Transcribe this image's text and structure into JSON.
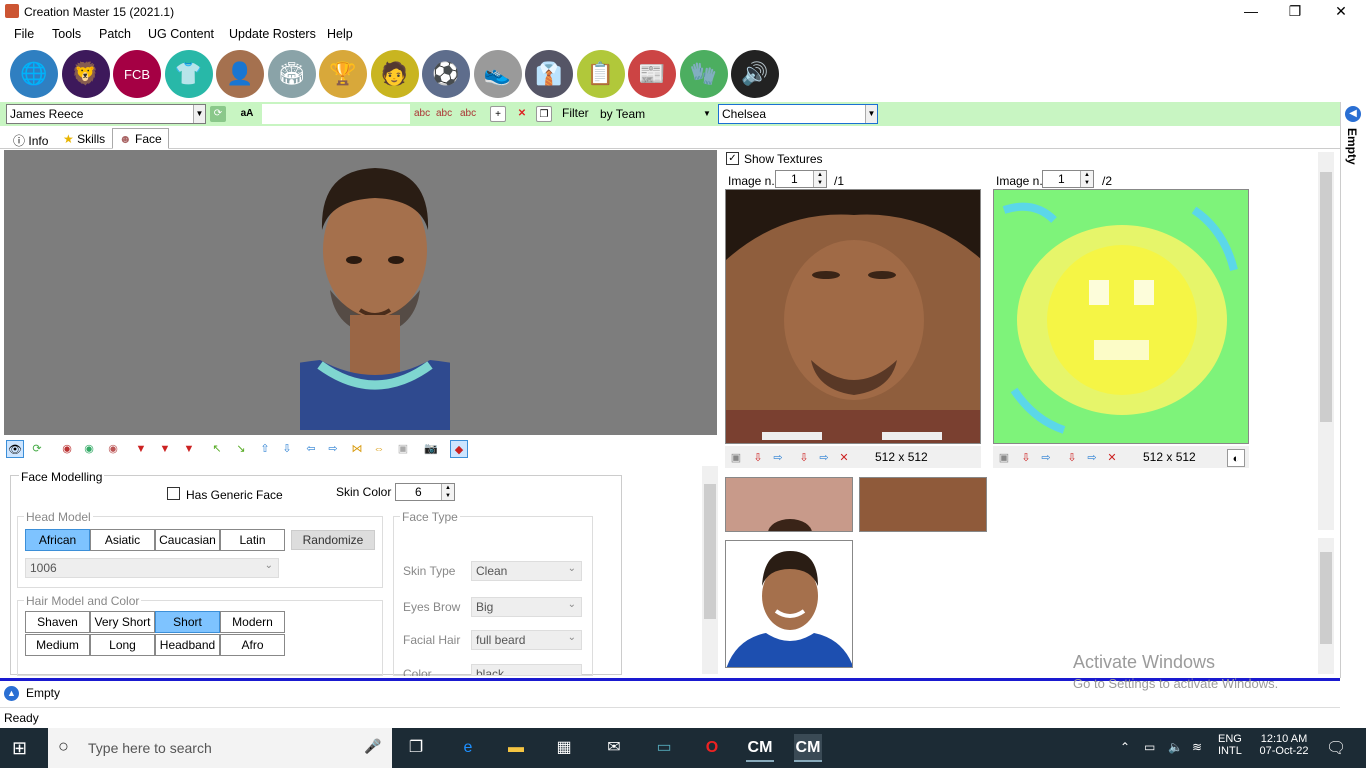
{
  "window": {
    "title": "Creation Master 15 (2021.1)",
    "minimize": "—",
    "maximize": "❐",
    "close": "✕"
  },
  "menu": [
    "File",
    "Tools",
    "Patch",
    "UG Content",
    "Update Rosters",
    "Help"
  ],
  "big_toolbar_icons": [
    {
      "name": "world-globe-icon",
      "color": "#2f7fc1",
      "glyph": "🌐"
    },
    {
      "name": "premier-league-icon",
      "color": "#3d195b",
      "glyph": "🦁"
    },
    {
      "name": "fc-barcelona-crest-icon",
      "color": "#a50044",
      "glyph": "FCB"
    },
    {
      "name": "jersey-icon",
      "color": "#28b8a8",
      "glyph": "👕"
    },
    {
      "name": "player-portrait-icon",
      "color": "#a5714f",
      "glyph": "👤"
    },
    {
      "name": "stadium-icon",
      "color": "#8aa3a8",
      "glyph": "🏟"
    },
    {
      "name": "world-cup-trophy-icon",
      "color": "#d8a83a",
      "glyph": "🏆"
    },
    {
      "name": "referee-icon",
      "color": "#c9b520",
      "glyph": "🧑"
    },
    {
      "name": "soccer-ball-icon",
      "color": "#5e6d8c",
      "glyph": "⚽"
    },
    {
      "name": "football-boot-icon",
      "color": "#9a9a9a",
      "glyph": "👟"
    },
    {
      "name": "manager-portrait-icon",
      "color": "#556",
      "glyph": "👔"
    },
    {
      "name": "tactics-board-icon",
      "color": "#b1c83a",
      "glyph": "📋"
    },
    {
      "name": "newspaper-icon",
      "color": "#c44",
      "glyph": "📰"
    },
    {
      "name": "goalkeeper-gloves-icon",
      "color": "#4cae60",
      "glyph": "🧤"
    },
    {
      "name": "speaker-icon",
      "color": "#222",
      "glyph": "🔊"
    }
  ],
  "green_toolbar": {
    "player_name": "James Reece",
    "case_button": "aA",
    "filter_label": "Filter",
    "filter_mode": "by Team",
    "team": "Chelsea"
  },
  "right_panel": {
    "label": "Empty"
  },
  "tabs": [
    {
      "label": "Info",
      "icon": "info-icon"
    },
    {
      "label": "Skills",
      "icon": "star-icon"
    },
    {
      "label": "Face",
      "icon": "face-icon",
      "active": true
    }
  ],
  "face_modelling": {
    "title": "Face Modelling",
    "generic_face_label": "Has Generic Face",
    "generic_face_checked": false,
    "skin_color_label": "Skin Color",
    "skin_color_value": "6",
    "head_model": {
      "legend": "Head Model",
      "buttons": [
        "African",
        "Asiatic",
        "Caucasian",
        "Latin"
      ],
      "selected": "African",
      "randomize": "Randomize",
      "model_value": "1006"
    },
    "hair": {
      "legend": "Hair Model and Color",
      "buttons": [
        "Shaven",
        "Very Short",
        "Short",
        "Modern",
        "Medium",
        "Long",
        "Headband",
        "Afro"
      ],
      "selected": "Short"
    },
    "face_type": {
      "legend": "Face Type",
      "fields": [
        {
          "label": "Skin Type",
          "value": "Clean"
        },
        {
          "label": "Eyes Brow",
          "value": "Big"
        },
        {
          "label": "Facial Hair",
          "value": "full beard"
        },
        {
          "label": "Color",
          "value": "black"
        }
      ]
    }
  },
  "textures": {
    "show_textures_label": "Show Textures",
    "show_textures_checked": true,
    "left": {
      "image_label": "Image n.",
      "image_value": "1",
      "total": "/1",
      "size": "512 x 512"
    },
    "right": {
      "image_label": "Image n.",
      "image_value": "1",
      "total": "/2",
      "size": "512 x 512"
    }
  },
  "bottom_panel": {
    "label": "Empty"
  },
  "status": "Ready",
  "watermark": {
    "title": "Activate Windows",
    "subtitle": "Go to Settings to activate Windows."
  },
  "taskbar": {
    "search_placeholder": "Type here to search",
    "lang_top": "ENG",
    "lang_bottom": "INTL",
    "time": "12:10 AM",
    "date": "07-Oct-22"
  }
}
